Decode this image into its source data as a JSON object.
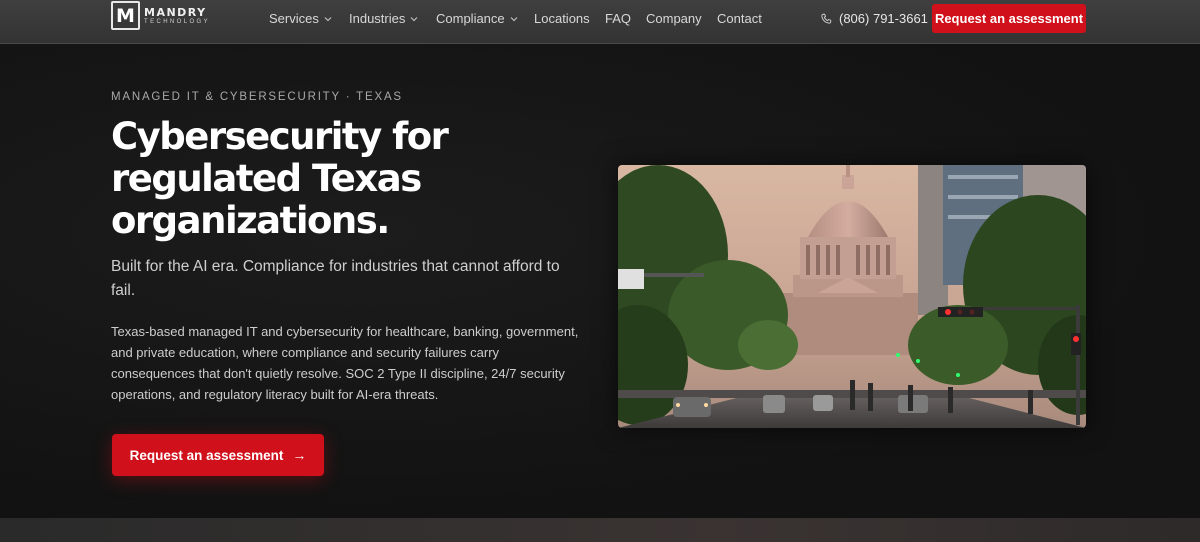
{
  "header": {
    "logo": {
      "name": "MANDRY",
      "sub": "TECHNOLOGY",
      "mark": "M"
    },
    "nav": [
      {
        "label": "Services",
        "dropdown": true
      },
      {
        "label": "Industries",
        "dropdown": true
      },
      {
        "label": "Compliance",
        "dropdown": true
      },
      {
        "label": "Locations",
        "dropdown": false
      },
      {
        "label": "FAQ",
        "dropdown": false
      },
      {
        "label": "Company",
        "dropdown": false
      },
      {
        "label": "Contact",
        "dropdown": false
      }
    ],
    "phone": "(806) 791-3661",
    "cta_label": "Request an assessment"
  },
  "hero": {
    "kicker": "MANAGED IT & CYBERSECURITY · TEXAS",
    "headline": "Cybersecurity for regulated Texas organizations.",
    "subhead": "Built for the AI era. Compliance for industries that cannot afford to fail.",
    "body": "Texas-based managed IT and cybersecurity for healthcare, banking, government, and private education, where compliance and security failures carry consequences that don't quietly resolve. SOC 2 Type II discipline, 24/7 security operations, and regulatory literacy built for AI-era threats.",
    "cta_label": "Request an assessment",
    "cta_arrow": "→"
  },
  "colors": {
    "accent": "#d0101a",
    "header_bg": "#383838",
    "hero_bg": "#141414"
  },
  "icons": {
    "phone": "phone-icon",
    "chevron": "chevron-down-icon",
    "arrow": "arrow-right-icon"
  }
}
